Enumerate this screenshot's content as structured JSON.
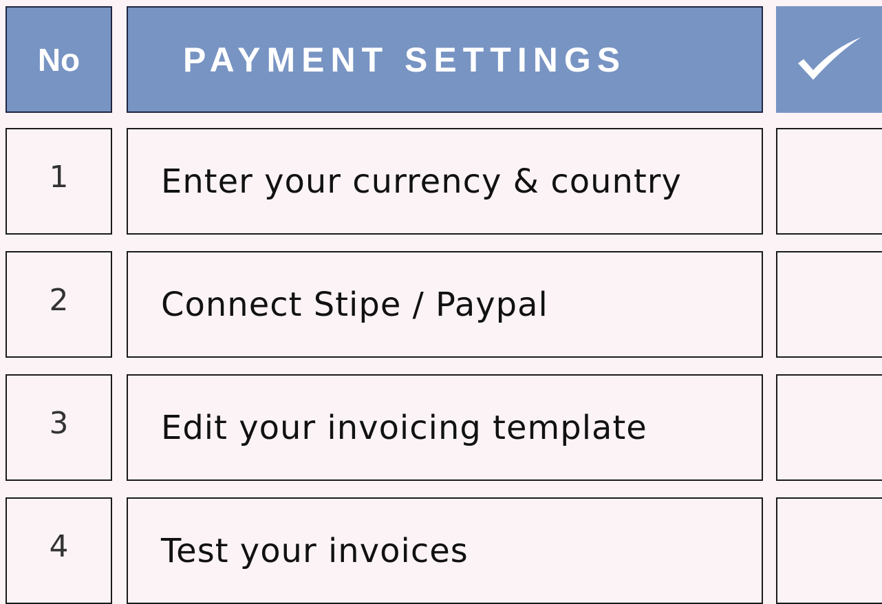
{
  "header": {
    "no_label": "No",
    "title": "PAYMENT SETTINGS",
    "check_icon": "checkmark-icon"
  },
  "colors": {
    "header_background": "#7894c3",
    "page_background": "#fbf3f5",
    "header_text": "#ffffff"
  },
  "rows": [
    {
      "number": "1",
      "task": "Enter your currency & country"
    },
    {
      "number": "2",
      "task": "Connect Stipe / Paypal"
    },
    {
      "number": "3",
      "task": "Edit your invoicing template"
    },
    {
      "number": "4",
      "task": "Test your invoices"
    }
  ]
}
